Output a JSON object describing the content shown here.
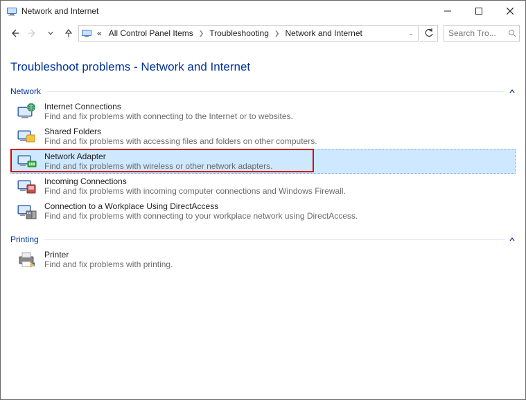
{
  "title": "Network and Internet",
  "breadcrumbs": {
    "prefix": "«",
    "items": [
      "All Control Panel Items",
      "Troubleshooting",
      "Network and Internet"
    ]
  },
  "search": {
    "placeholder": "Search Tro..."
  },
  "page_heading": "Troubleshoot problems - Network and Internet",
  "sections": {
    "network": {
      "label": "Network",
      "items": [
        {
          "title": "Internet Connections",
          "desc": "Find and fix problems with connecting to the Internet or to websites."
        },
        {
          "title": "Shared Folders",
          "desc": "Find and fix problems with accessing files and folders on other computers."
        },
        {
          "title": "Network Adapter",
          "desc": "Find and fix problems with wireless or other network adapters."
        },
        {
          "title": "Incoming Connections",
          "desc": "Find and fix problems with incoming computer connections and Windows Firewall."
        },
        {
          "title": "Connection to a Workplace Using DirectAccess",
          "desc": "Find and fix problems with connecting to your workplace network using DirectAccess."
        }
      ]
    },
    "printing": {
      "label": "Printing",
      "items": [
        {
          "title": "Printer",
          "desc": "Find and fix problems with printing."
        }
      ]
    }
  }
}
